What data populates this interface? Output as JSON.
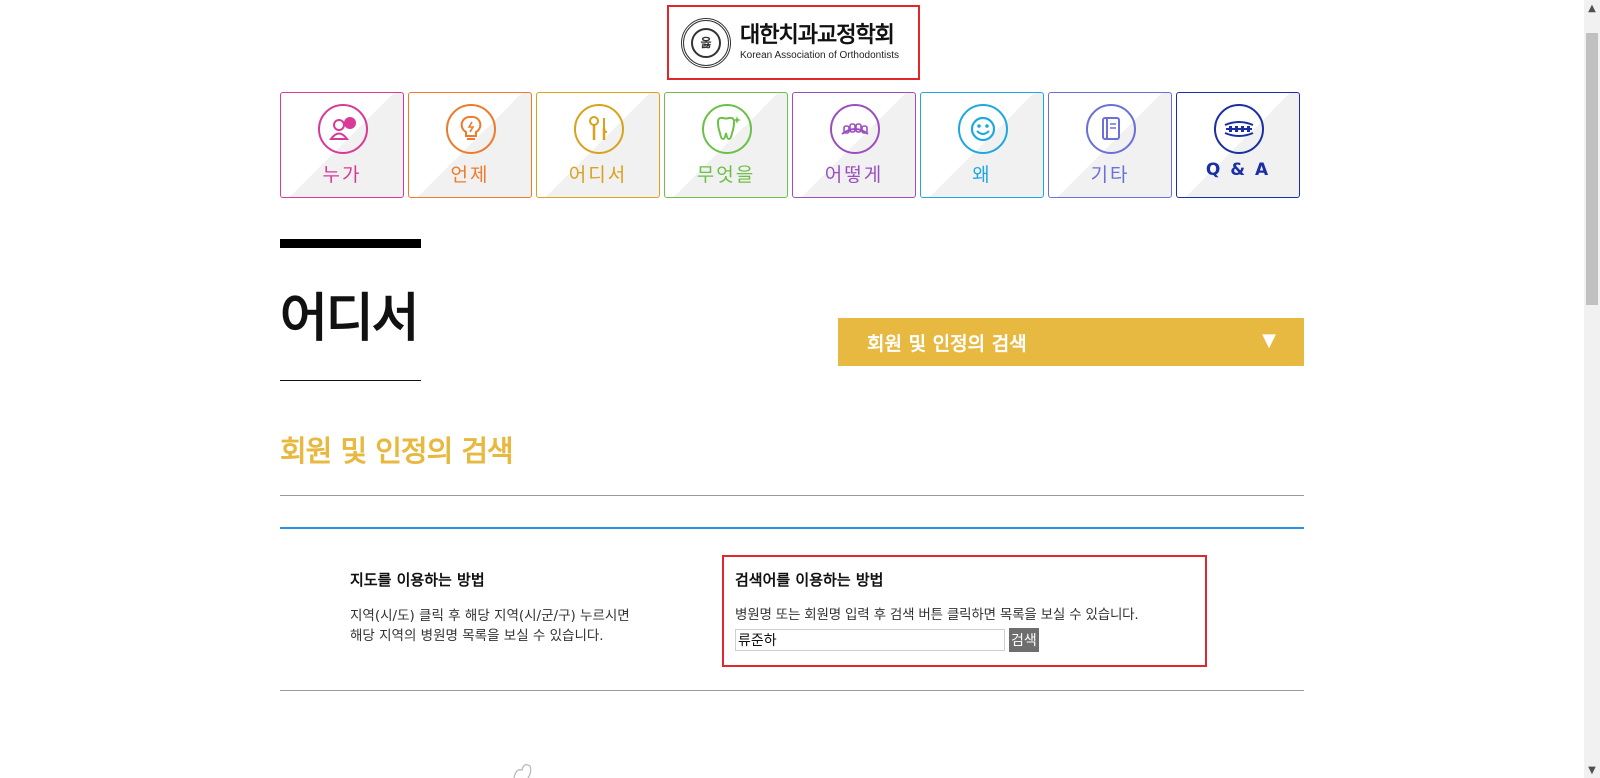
{
  "logo": {
    "emblem_text": "옳",
    "title_ko": "대한치과교정학회",
    "title_en": "Korean Association of Orthodontists"
  },
  "nav": {
    "tiles": [
      {
        "label": "누가",
        "color": "#d93a96",
        "icon": "person-chat-icon"
      },
      {
        "label": "언제",
        "color": "#ef7a2a",
        "icon": "lightbulb-icon"
      },
      {
        "label": "어디서",
        "color": "#d9a21c",
        "icon": "dental-tools-icon"
      },
      {
        "label": "무엇을",
        "color": "#6cc04a",
        "icon": "tooth-sparkle-icon"
      },
      {
        "label": "어떻게",
        "color": "#9b4fbf",
        "icon": "teeth-icon"
      },
      {
        "label": "왜",
        "color": "#1fa8e0",
        "icon": "smiley-icon"
      },
      {
        "label": "기타",
        "color": "#6a70d8",
        "icon": "book-icon"
      },
      {
        "label": "Q & A",
        "color": "#1a2ea6",
        "icon": "braces-icon"
      }
    ]
  },
  "page": {
    "title": "어디서",
    "section_heading": "회원 및 인정의 검색"
  },
  "dropdown": {
    "label": "회원 및 인정의 검색",
    "arrow": "▼"
  },
  "map_method": {
    "heading": "지도를 이용하는 방법",
    "line1": "지역(시/도) 클릭 후 해당 지역(시/군/구) 누르시면",
    "line2": "해당 지역의 병원명 목록을 보실 수 있습니다."
  },
  "keyword_method": {
    "heading": "검색어를 이용하는 방법",
    "description": "병원명 또는 회원명 입력 후 검색 버튼 클릭하면 목록을 보실 수 있습니다.",
    "input_value": "류준하",
    "button_label": "검색"
  },
  "colors": {
    "accent": "#e8b940",
    "highlight_border": "#e3262c",
    "blue_rule": "#2d8fe0"
  },
  "scrollbar": {
    "up_arrow": "▲",
    "down_arrow": "▼"
  }
}
